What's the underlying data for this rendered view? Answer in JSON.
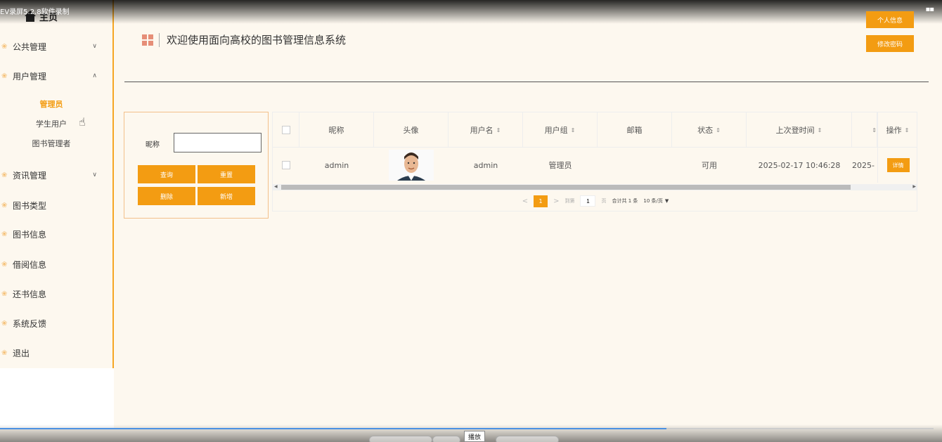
{
  "recorder_label": "EV录屏5.2.8软件录制",
  "sidebar": {
    "home_label": "主页",
    "menu": [
      {
        "label": "公共管理",
        "chev": "∨"
      },
      {
        "label": "用户管理",
        "chev": "∧"
      },
      {
        "label": "资讯管理",
        "chev": "∨"
      },
      {
        "label": "图书类型"
      },
      {
        "label": "图书信息"
      },
      {
        "label": "借阅信息"
      },
      {
        "label": "还书信息"
      },
      {
        "label": "系统反馈"
      },
      {
        "label": "退出"
      }
    ],
    "sub_items": [
      "管理员",
      "学生用户",
      "图书管理者"
    ]
  },
  "header": {
    "title": "欢迎使用面向高校的图书管理信息系统",
    "profile_button": "个人信息",
    "password_button": "修改密码"
  },
  "search": {
    "nick_label": "昵称",
    "nick_value": "",
    "query_button": "查询",
    "reset_button": "重置",
    "delete_button": "删除",
    "add_button": "新增"
  },
  "table": {
    "columns": [
      "昵称",
      "头像",
      "用户名",
      "用户组",
      "邮箱",
      "状态",
      "上次登时间",
      "",
      "操作"
    ],
    "rows": [
      {
        "nickname": "admin",
        "username": "admin",
        "group": "管理员",
        "email": "",
        "status": "可用",
        "last_login": "2025-02-17 10:46:28",
        "cut_value": "2025-",
        "action": "详情"
      }
    ]
  },
  "pager": {
    "prev": "<",
    "current": "1",
    "next": ">",
    "goto_label": "到第",
    "goto_value": "1",
    "page_unit": "页",
    "total": "合计共 1 条",
    "page_size": "10 条/页"
  },
  "player": {
    "play_tip": "播放"
  }
}
